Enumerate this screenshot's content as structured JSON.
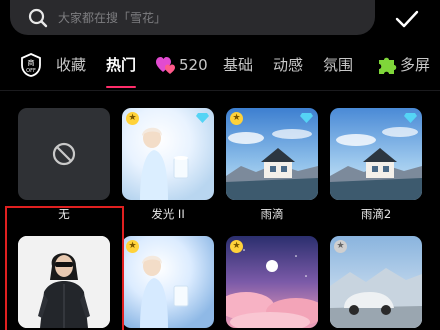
{
  "search": {
    "placeholder": "大家都在搜「雪花」"
  },
  "tabs": [
    {
      "label": "收藏",
      "icon": "heart-off-icon"
    },
    {
      "label": "热门",
      "active": true
    },
    {
      "label": "520",
      "icon": "hearts-icon"
    },
    {
      "label": "基础"
    },
    {
      "label": "动感"
    },
    {
      "label": "氛围"
    },
    {
      "label": "多屏",
      "icon": "puzzle-icon"
    }
  ],
  "effects": [
    {
      "label": "无",
      "icon": "none-icon"
    },
    {
      "label": "发光 II",
      "badge": "star-icon",
      "tag": "gem-icon"
    },
    {
      "label": "雨滴",
      "badge": "star-icon",
      "tag": "gem-icon"
    },
    {
      "label": "雨滴2",
      "tag": "gem-icon"
    },
    {
      "label": "",
      "selected": true
    },
    {
      "label": "",
      "badge": "star-icon"
    },
    {
      "label": "",
      "badge": "star-icon"
    },
    {
      "label": "",
      "badge": "star-icon"
    }
  ],
  "colors": {
    "accent": "#ff2d6a",
    "selection": "#e02020",
    "background": "#000000"
  }
}
